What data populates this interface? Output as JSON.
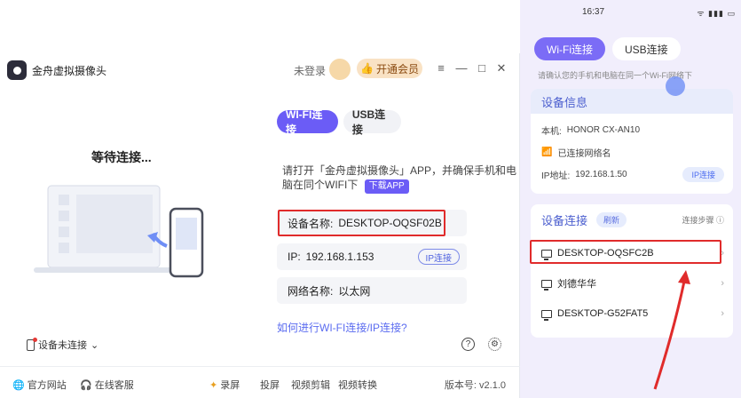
{
  "app": {
    "title": "金舟虚拟摄像头",
    "login_label": "未登录",
    "vip_label": "开通会员",
    "window_controls": [
      "≡",
      "—",
      "□",
      "✕"
    ]
  },
  "left": {
    "waiting_title": "等待连接..."
  },
  "tabs": [
    {
      "label": "WI-FI连接",
      "active": true
    },
    {
      "label": "USB连接",
      "active": false
    }
  ],
  "instructions": {
    "text": "请打开「金舟虚拟摄像头」APP，并确保手机和电脑在同个WIFI下",
    "download_label": "下载APP"
  },
  "connection": {
    "device_name_key": "设备名称:",
    "device_name": "DESKTOP-OQSF02B",
    "ip_key": "IP:",
    "ip": "192.168.1.153",
    "ip_connect_label": "IP连接",
    "network_key": "网络名称:",
    "network": "以太网"
  },
  "help_link": "如何进行WI-FI连接/IP连接?",
  "device_status": "设备未连接",
  "bottom_bar": {
    "website": "官方网站",
    "support": "在线客服",
    "record": "录屏",
    "cast": "投屏",
    "video_edit": "视频剪辑",
    "video_convert": "视频转换",
    "version": "版本号: v2.1.0"
  },
  "phone": {
    "time": "16:37",
    "status_icons": "ᯤ ▮▮▮ ▭",
    "tabs": [
      {
        "label": "Wi-Fi连接",
        "active": true
      },
      {
        "label": "USB连接",
        "active": false
      }
    ],
    "note": "请确认您的手机和电脑在同一个Wi-Fi网络下",
    "device_info": {
      "title": "设备信息",
      "model_key": "本机:",
      "model": "HONOR CX-AN10",
      "wifi": "已连接网络名",
      "ip_key": "IP地址:",
      "ip": "192.168.1.50",
      "ip_connect_label": "IP连接"
    },
    "device_list": {
      "title": "设备连接",
      "refresh_label": "刷新",
      "steps_link": "连接步骤 ⓘ",
      "items": [
        "DESKTOP-OQSFC2B",
        "刘德华华",
        "DESKTOP-G52FAT5"
      ]
    }
  },
  "colors": {
    "accent": "#6b5cf6",
    "highlight": "#e02b2b",
    "phone_bg": "#f1eefc"
  }
}
